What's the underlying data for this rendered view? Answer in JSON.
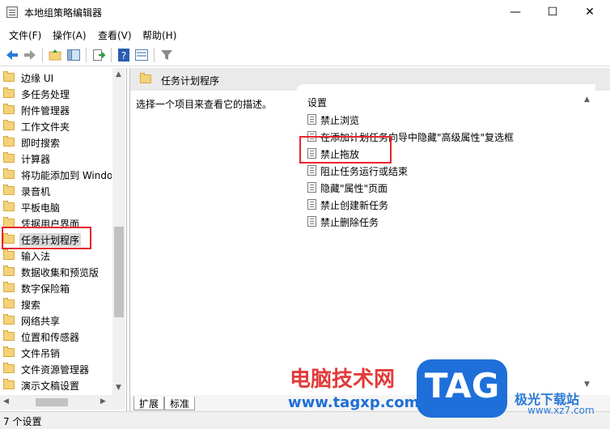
{
  "window": {
    "title": "本地组策略编辑器",
    "minimize": "—",
    "maximize": "☐",
    "close": "✕"
  },
  "menu": [
    "文件(F)",
    "操作(A)",
    "查看(V)",
    "帮助(H)"
  ],
  "tree": {
    "items": [
      "边缘 UI",
      "多任务处理",
      "附件管理器",
      "工作文件夹",
      "即时搜索",
      "计算器",
      "将功能添加到 Windows",
      "录音机",
      "平板电脑",
      "凭据用户界面",
      "任务计划程序",
      "输入法",
      "数据收集和预览版",
      "数字保险箱",
      "搜索",
      "网络共享",
      "位置和传感器",
      "文件吊销",
      "文件资源管理器",
      "演示文稿设置"
    ],
    "selected_index": 10
  },
  "details": {
    "header_title": "任务计划程序",
    "description": "选择一个项目来查看它的描述。",
    "column_header": "设置",
    "settings": [
      "禁止浏览",
      "在添加计划任务向导中隐藏\"高级属性\"复选框",
      "禁止拖放",
      "阻止任务运行或结束",
      "隐藏\"属性\"页面",
      "禁止创建新任务",
      "禁止删除任务"
    ],
    "tabs": [
      "扩展",
      "标准"
    ]
  },
  "status": {
    "text": "7 个设置"
  },
  "watermark": {
    "cn_text": "电脑技术网",
    "url": "www.tagxp.com",
    "badge": "TAG",
    "site2": "极光下载站",
    "url2": "www.xz7.com"
  },
  "colors": {
    "highlight_red": "#e6262d",
    "folder": "#f3d27a"
  },
  "icons": {
    "back": "back-arrow-icon",
    "forward": "forward-arrow-icon",
    "filter": "filter-icon",
    "help": "help-icon"
  }
}
